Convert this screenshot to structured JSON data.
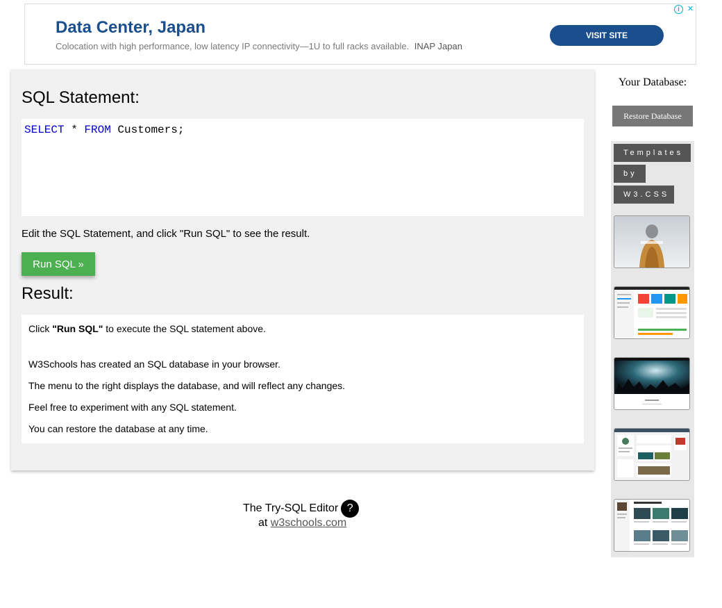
{
  "ad": {
    "title": "Data Center, Japan",
    "description": "Colocation with high performance, low latency IP connectivity—1U to full racks available.",
    "brand": "INAP Japan",
    "cta": "VISIT SITE",
    "info_icon": "i",
    "close_icon": "✕"
  },
  "editor": {
    "heading": "SQL Statement:",
    "keyword1": "SELECT",
    "middle": " * ",
    "keyword2": "FROM",
    "rest": " Customers;",
    "instructions": "Edit the SQL Statement, and click \"Run SQL\" to see the result.",
    "run_button": "Run SQL »"
  },
  "result": {
    "heading": "Result:",
    "click_prefix": "Click ",
    "click_bold": "\"Run SQL\"",
    "click_suffix": " to execute the SQL statement above.",
    "lines": [
      "W3Schools has created an SQL database in your browser.",
      "The menu to the right displays the database, and will reflect any changes.",
      "Feel free to experiment with any SQL statement.",
      "You can restore the database at any time."
    ]
  },
  "footer": {
    "editor_label": "The Try-SQL Editor",
    "help_icon": "?",
    "at": "at ",
    "link": "w3schools.com"
  },
  "sidebar": {
    "your_database": "Your Database:",
    "restore_button": "Restore Database",
    "templates_tags": [
      "Templates",
      "by",
      "W3.CSS"
    ]
  }
}
